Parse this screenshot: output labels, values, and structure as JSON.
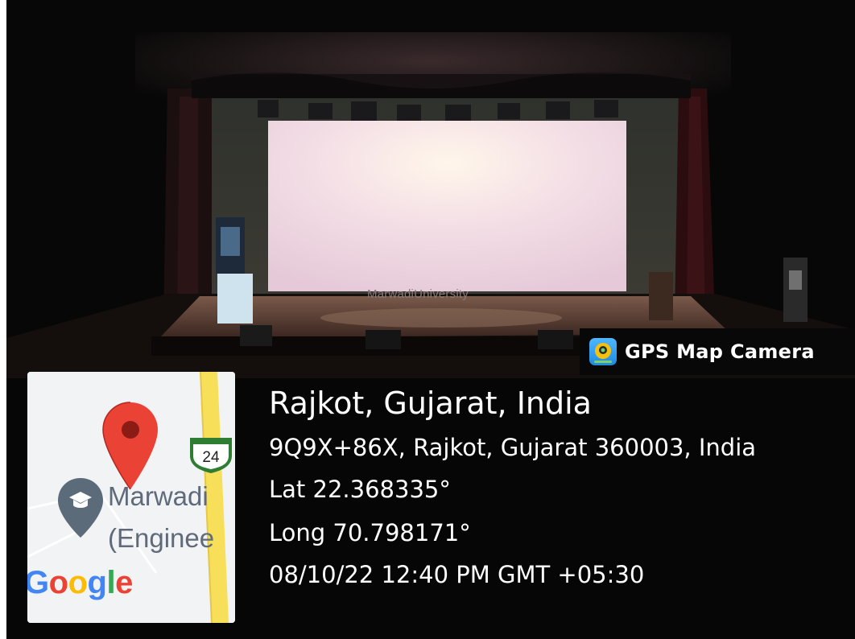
{
  "photo": {
    "stage_branding": "MarwadiUniversity"
  },
  "badge": {
    "app_name": "GPS Map Camera",
    "icon": "gps-map-camera-app-icon"
  },
  "map": {
    "place_label_line1": "Marwadi",
    "place_label_line2": "(Enginee",
    "route_shield": "24",
    "logo_text": [
      "G",
      "o",
      "o",
      "g",
      "l",
      "e"
    ],
    "logo_colors": [
      "#4285F4",
      "#EA4335",
      "#FBBC05",
      "#4285F4",
      "#34A853",
      "#EA4335"
    ],
    "pin_icon": "map-pin-icon",
    "place_icon": "graduation-cap-icon",
    "pin_color": "#EA4335",
    "place_pin_color": "#5c6b7a",
    "road_color": "#f7df5a"
  },
  "info": {
    "title": "Rajkot, Gujarat, India",
    "address": "9Q9X+86X, Rajkot, Gujarat 360003, India",
    "latitude": "Lat 22.368335°",
    "longitude": "Long 70.798171°",
    "datetime": "08/10/22 12:40 PM GMT +05:30"
  }
}
